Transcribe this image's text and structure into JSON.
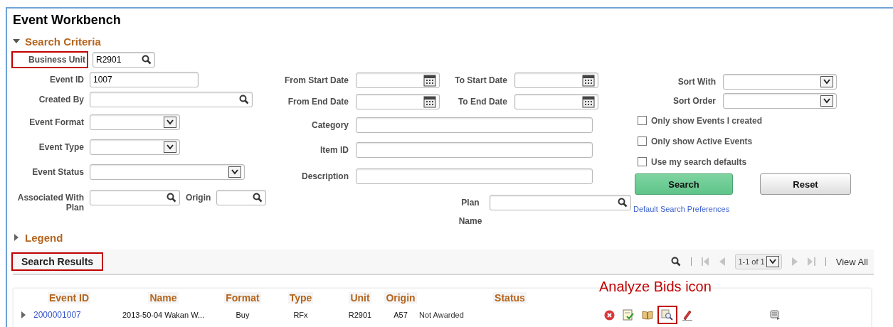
{
  "title": "Event Workbench",
  "search_criteria": {
    "label": "Search Criteria",
    "expanded": true
  },
  "left_fields": [
    {
      "kind": "lookup",
      "label": "Business Unit",
      "value": "R2901",
      "highlighted": true
    },
    {
      "kind": "text",
      "label": "Event ID",
      "value": "1007",
      "highlighted": false
    },
    {
      "kind": "lookup",
      "label": "Created By",
      "highlighted": false
    },
    {
      "kind": "select",
      "label": "Event Format",
      "highlighted": false
    },
    {
      "kind": "select",
      "label": "Event Type",
      "highlighted": false
    },
    {
      "kind": "select",
      "label": "Event Status",
      "highlighted": false
    },
    {
      "kind": "lookup",
      "label": "Associated With Plan",
      "highlighted": false,
      "inline": {
        "kind": "lookup",
        "label": "Origin"
      }
    }
  ],
  "date_rows": [
    {
      "fields": [
        {
          "kind": "date",
          "label": "From Start Date"
        },
        {
          "kind": "date",
          "label": "To Start Date"
        }
      ]
    },
    {
      "fields": [
        {
          "kind": "date",
          "label": "From End Date"
        },
        {
          "kind": "date",
          "label": "To End Date"
        }
      ]
    }
  ],
  "middle_fields": [
    {
      "kind": "text",
      "label": "Category"
    },
    {
      "kind": "text",
      "label": "Item ID"
    },
    {
      "kind": "text",
      "label": "Description"
    },
    {
      "kind": "lookup",
      "label": "Plan Name"
    }
  ],
  "sort_fields": [
    {
      "kind": "select",
      "label": "Sort With"
    },
    {
      "kind": "select",
      "label": "Sort Order"
    }
  ],
  "options": [
    {
      "label": "Only show Events I created",
      "checked": false
    },
    {
      "label": "Only show Active Events",
      "checked": false
    },
    {
      "label": "Use my search defaults",
      "checked": false
    }
  ],
  "buttons": [
    {
      "kind": "primary",
      "label": "Search"
    },
    {
      "kind": "secondary",
      "label": "Reset"
    }
  ],
  "link": "Default Search Preferences",
  "legend": {
    "label": "Legend",
    "expanded": false
  },
  "results": {
    "title": "Search Results",
    "highlighted": true,
    "toolbar": [
      {
        "kind": "find",
        "disabled": false
      },
      {
        "kind": "first",
        "disabled": true
      },
      {
        "kind": "prev",
        "disabled": true
      },
      {
        "kind": "page",
        "label": "1-1 of 1",
        "disabled": false
      },
      {
        "kind": "next",
        "disabled": true
      },
      {
        "kind": "last",
        "disabled": true
      },
      {
        "kind": "view_all",
        "label": "View All",
        "disabled": false
      }
    ],
    "columns": [
      "Event ID",
      "Name",
      "Format",
      "Type",
      "Unit",
      "Origin",
      "Status"
    ],
    "rows": [
      {
        "expanded": false,
        "cells": [
          "2000001007",
          "2013-50-04 Wakan W...",
          "Buy",
          "RFx",
          "R2901",
          "A57",
          "Not Awarded"
        ],
        "actions": [
          {
            "kind": "cancel",
            "highlighted": false
          },
          {
            "kind": "approve",
            "highlighted": false
          },
          {
            "kind": "book",
            "highlighted": false
          },
          {
            "kind": "analyze",
            "highlighted": true
          },
          {
            "kind": "edit",
            "highlighted": false
          },
          {
            "kind": "scroll",
            "highlighted": false
          }
        ]
      }
    ],
    "callout": "Analyze Bids icon"
  }
}
